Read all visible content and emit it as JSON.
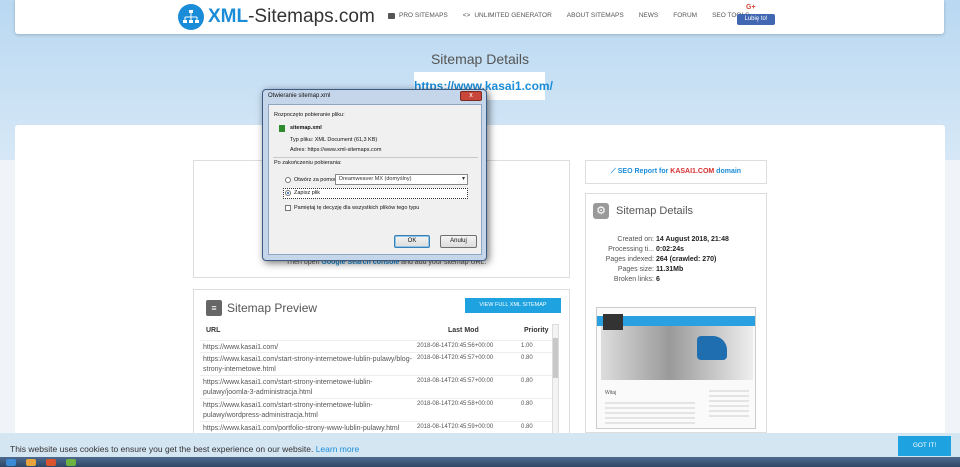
{
  "header": {
    "logo_prefix": "XML",
    "logo_suffix": "-Sitemaps.com",
    "nav": [
      {
        "label": "PRO SITEMAPS",
        "icon": "pro-sitemaps-icon"
      },
      {
        "label": "UNLIMITED GENERATOR",
        "icon": "code-icon"
      },
      {
        "label": "ABOUT SITEMAPS"
      },
      {
        "label": "NEWS"
      },
      {
        "label": "FORUM"
      },
      {
        "label": "SEO TOOLS"
      }
    ],
    "gplus_label": "G+",
    "fb_like_label": "Lubię to!"
  },
  "page": {
    "title": "Sitemap Details",
    "site_url": "https://www.kasai1.com/"
  },
  "instructions": {
    "prefix": "Then open ",
    "link": "Google Search console",
    "suffix": " and add your sitemap URL."
  },
  "preview": {
    "title": "Sitemap Preview",
    "view_button": "VIEW FULL XML SITEMAP",
    "columns": {
      "url": "URL",
      "lastmod": "Last Mod",
      "priority": "Priority"
    },
    "rows": [
      {
        "url": "https://www.kasai1.com/",
        "lastmod": "2018-08-14T20:45:56+00:00",
        "priority": "1.00"
      },
      {
        "url": "https://www.kasai1.com/start-strony-internetowe-lublin-pulawy/blog-strony-internetowe.html",
        "lastmod": "2018-08-14T20:45:57+00:00",
        "priority": "0.80"
      },
      {
        "url": "https://www.kasai1.com/start-strony-internetowe-lublin-pulawy/joomla-3-administracja.html",
        "lastmod": "2018-08-14T20:45:57+00:00",
        "priority": "0.80"
      },
      {
        "url": "https://www.kasai1.com/start-strony-internetowe-lublin-pulawy/wordpress-administracja.html",
        "lastmod": "2018-08-14T20:45:58+00:00",
        "priority": "0.80"
      },
      {
        "url": "https://www.kasai1.com/portfolio-strony-www-lublin-pulawy.html",
        "lastmod": "2018-08-14T20:45:59+00:00",
        "priority": "0.80"
      }
    ]
  },
  "seo_report": {
    "prefix": "SEO Report for ",
    "domain": "KASAI1.COM",
    "suffix": " domain"
  },
  "details": {
    "title": "Sitemap Details",
    "items": [
      {
        "label": "Created on:",
        "value": "14 August 2018, 21:48"
      },
      {
        "label": "Processing ti...",
        "value": "0:02:24s"
      },
      {
        "label": "Pages indexed:",
        "value": "264 (crawled: 270)"
      },
      {
        "label": "Pages size:",
        "value": "11.31Mb"
      },
      {
        "label": "Broken links:",
        "value": "6"
      }
    ]
  },
  "thumbnail": {
    "heading": "Witaj"
  },
  "cookie": {
    "text": "This website uses cookies to ensure you get the best experience on our website. ",
    "link": "Learn more",
    "button": "GOT IT!"
  },
  "dialog": {
    "title": "Otwieranie sitemap.xml",
    "close": "x",
    "intro": "Rozpoczęto pobieranie pliku:",
    "filename": "sitemap.xml",
    "type_label": "Typ pliku:",
    "type_value": "XML Document (61,3 KB)",
    "address_label": "Adres:",
    "address_value": "https://www.xml-sitemaps.com",
    "after_label": "Po zakończeniu pobierania:",
    "open_with_label": "Otwórz za pomocą",
    "open_with_app": "Dreamweaver MX (domyślny)",
    "save_label": "Zapisz plik",
    "remember_label": "Pamiętaj tę decyzję dla wszystkich plików tego typu",
    "ok_label": "OK",
    "cancel_label": "Anuluj"
  },
  "colors": {
    "brand": "#1a8cd8",
    "button_blue": "#1fa3e0",
    "seo_domain_red": "#d32f2f"
  }
}
